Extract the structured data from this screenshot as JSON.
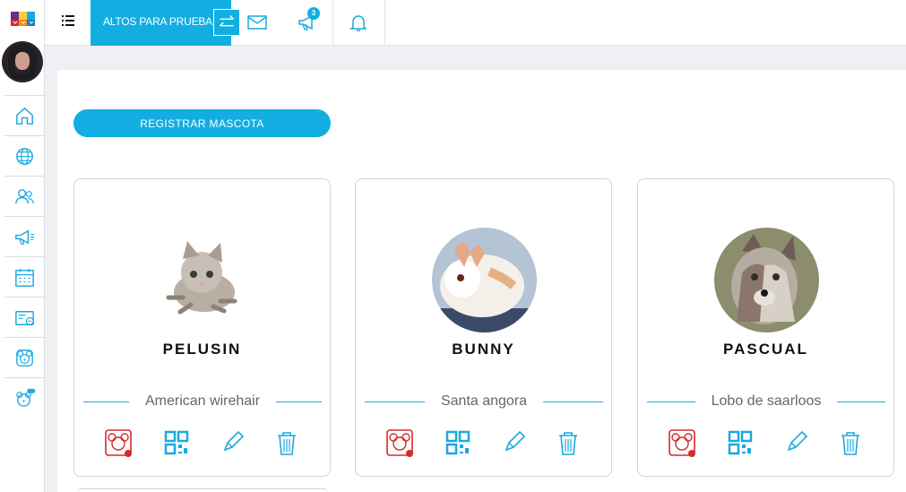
{
  "topbar": {
    "company": "ALTOS PARA PRUEBA",
    "notification_count": "3",
    "icons": [
      "menu-icon",
      "swap-icon",
      "mail-icon",
      "megaphone-icon",
      "bell-icon"
    ]
  },
  "sidebar": {
    "items": [
      {
        "icon": "home-icon"
      },
      {
        "icon": "globe-icon"
      },
      {
        "icon": "users-icon"
      },
      {
        "icon": "megaphone-icon"
      },
      {
        "icon": "calendar-icon"
      },
      {
        "icon": "id-card-icon"
      },
      {
        "icon": "pet-icon"
      },
      {
        "icon": "pet-support-icon"
      }
    ]
  },
  "main": {
    "register_button": "REGISTRAR MASCOTA",
    "pets": [
      {
        "name": "PELUSIN",
        "breed": "American wirehair"
      },
      {
        "name": "BUNNY",
        "breed": "Santa angora"
      },
      {
        "name": "PASCUAL",
        "breed": "Lobo de saarloos"
      }
    ]
  },
  "colors": {
    "accent": "#12aee1",
    "danger": "#d32b2b"
  }
}
